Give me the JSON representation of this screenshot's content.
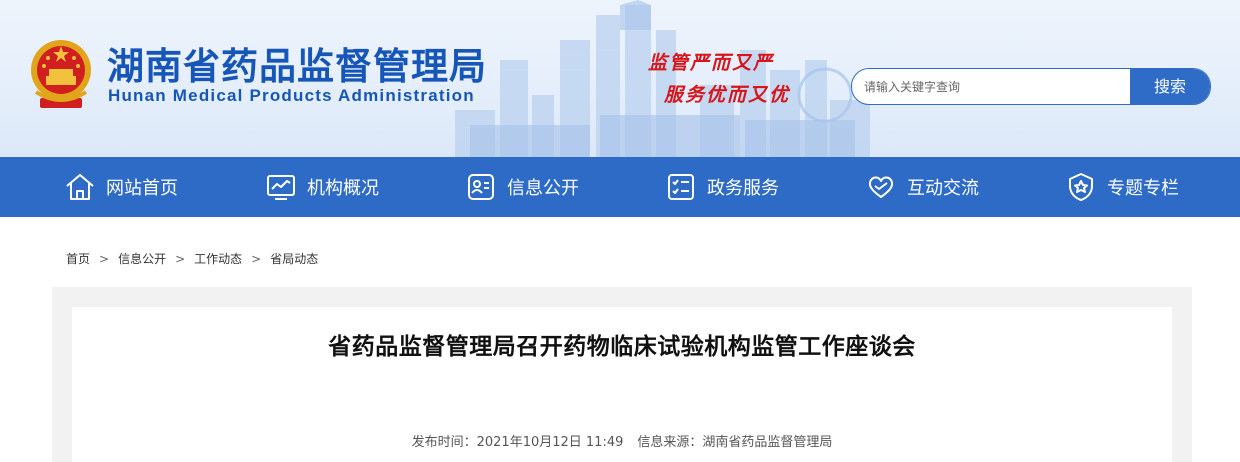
{
  "header": {
    "title": "湖南省药品监督管理局",
    "subtitle": "Hunan Medical Products Administration",
    "slogan_line1": "监管严而又严",
    "slogan_line2": "服务优而又优"
  },
  "search": {
    "placeholder": "请输入关键字查询",
    "button_label": "搜索"
  },
  "nav": {
    "items": [
      {
        "label": "网站首页",
        "icon": "home-icon"
      },
      {
        "label": "机构概况",
        "icon": "monitor-chart-icon"
      },
      {
        "label": "信息公开",
        "icon": "id-card-icon"
      },
      {
        "label": "政务服务",
        "icon": "checklist-icon"
      },
      {
        "label": "互动交流",
        "icon": "heart-hands-icon"
      },
      {
        "label": "专题专栏",
        "icon": "shield-star-icon"
      }
    ]
  },
  "breadcrumb": {
    "items": [
      "首页",
      "信息公开",
      "工作动态",
      "省局动态"
    ],
    "separator": ">"
  },
  "article": {
    "title": "省药品监督管理局召开药物临床试验机构监管工作座谈会",
    "publish_label": "发布时间：",
    "publish_time": "2021年10月12日 11:49",
    "source_label": "信息来源：",
    "source": "湖南省药品监督管理局"
  },
  "colors": {
    "brand_blue": "#2d6bc6",
    "title_blue": "#1556b8",
    "slogan_red": "#d6161b"
  }
}
